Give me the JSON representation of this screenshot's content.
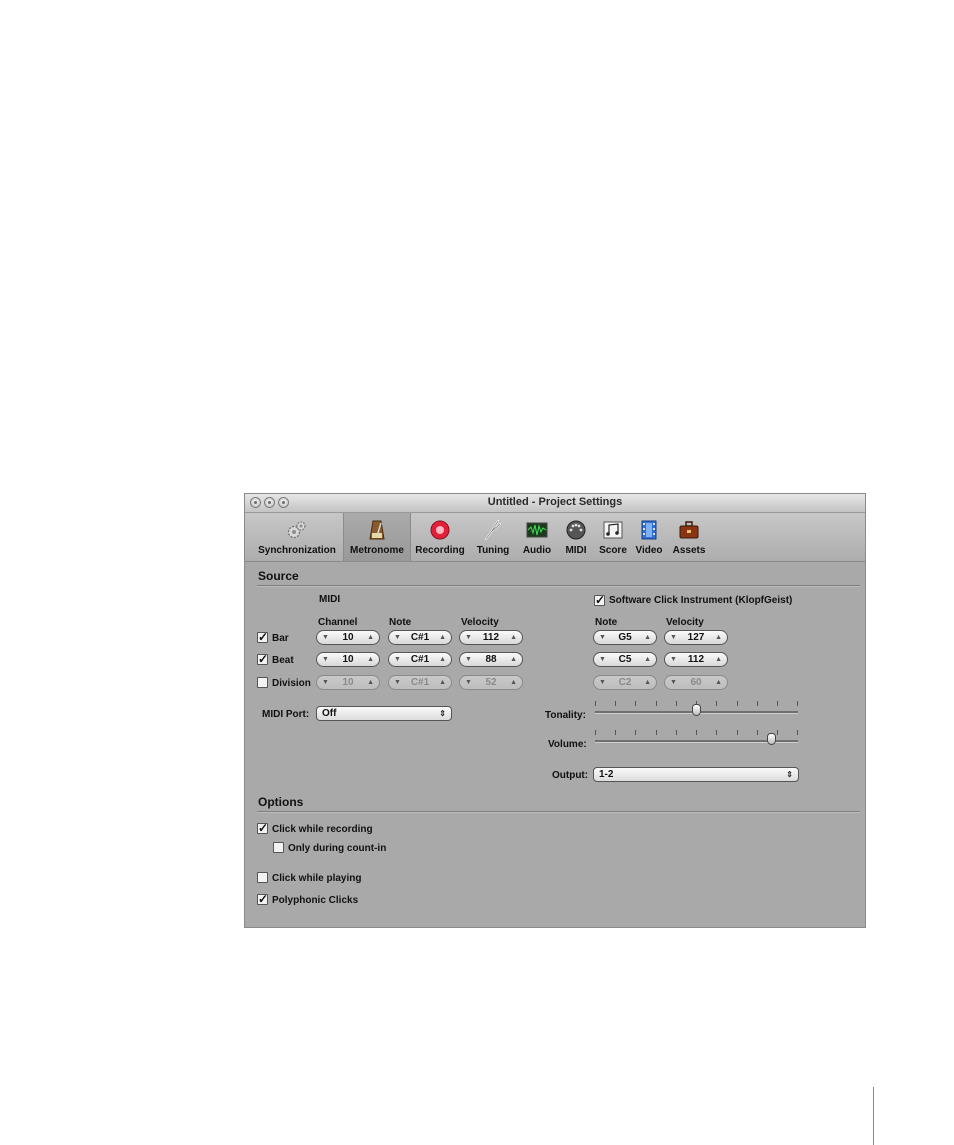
{
  "window": {
    "title": "Untitled - Project Settings"
  },
  "toolbar": {
    "items": [
      {
        "label": "Synchronization",
        "icon": "gears-icon"
      },
      {
        "label": "Metronome",
        "icon": "metronome-icon",
        "selected": true
      },
      {
        "label": "Recording",
        "icon": "record-icon"
      },
      {
        "label": "Tuning",
        "icon": "tuning-fork-icon"
      },
      {
        "label": "Audio",
        "icon": "waveform-icon"
      },
      {
        "label": "MIDI",
        "icon": "midi-port-icon"
      },
      {
        "label": "Score",
        "icon": "notes-icon"
      },
      {
        "label": "Video",
        "icon": "filmstrip-icon"
      },
      {
        "label": "Assets",
        "icon": "briefcase-icon"
      }
    ]
  },
  "source": {
    "heading": "Source",
    "midi_label": "MIDI",
    "columns": {
      "channel": "Channel",
      "note": "Note",
      "velocity": "Velocity"
    },
    "software_click": {
      "label": "Software Click Instrument (KlopfGeist)",
      "checked": true
    },
    "rows": [
      {
        "label": "Bar",
        "checked": true,
        "channel": "10",
        "note": "C#1",
        "velocity": "112",
        "sw_note": "G5",
        "sw_velocity": "127"
      },
      {
        "label": "Beat",
        "checked": true,
        "channel": "10",
        "note": "C#1",
        "velocity": "88",
        "sw_note": "C5",
        "sw_velocity": "112"
      },
      {
        "label": "Division",
        "checked": false,
        "channel": "10",
        "note": "C#1",
        "velocity": "52",
        "sw_note": "C2",
        "sw_velocity": "60"
      }
    ],
    "midi_port": {
      "label": "MIDI Port:",
      "value": "Off"
    },
    "tonality": {
      "label": "Tonality:",
      "level": 0.5
    },
    "volume": {
      "label": "Volume:",
      "level": 0.87
    },
    "output": {
      "label": "Output:",
      "value": "1-2"
    }
  },
  "options": {
    "heading": "Options",
    "items": [
      {
        "label": "Click while recording",
        "checked": true
      },
      {
        "label": "Only during count-in",
        "checked": false
      },
      {
        "label": "Click while playing",
        "checked": false
      },
      {
        "label": "Polyphonic Clicks",
        "checked": true
      }
    ]
  },
  "colors": {
    "window_bg": "#a9a9a9",
    "record_red": "#e2203a"
  }
}
